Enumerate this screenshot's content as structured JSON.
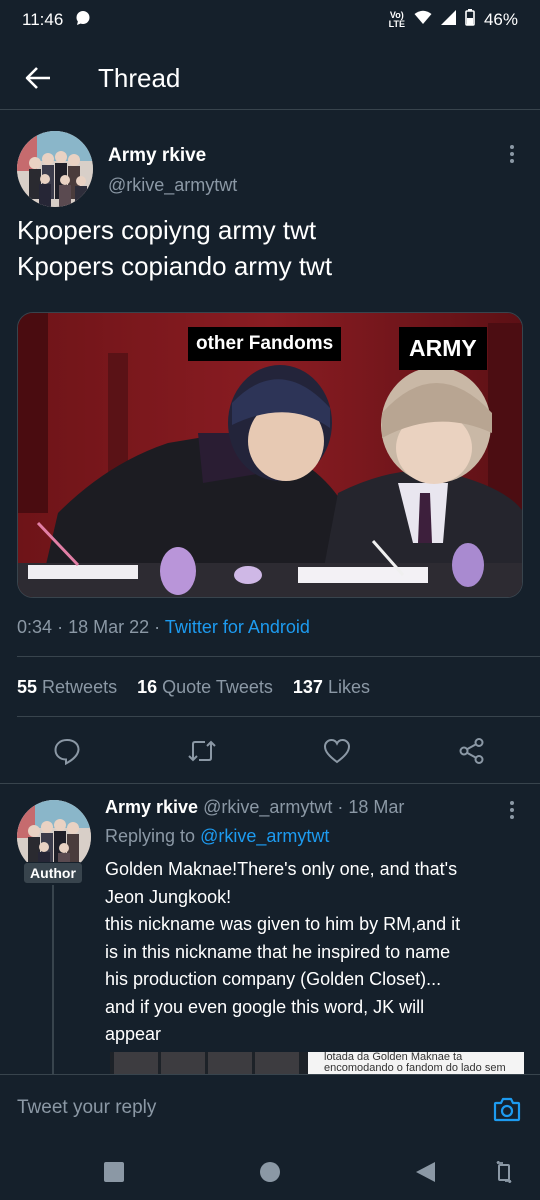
{
  "status_bar": {
    "time": "11:46",
    "volte_line1": "Vo)",
    "volte_line2": "LTE",
    "battery": "46%"
  },
  "header": {
    "title": "Thread",
    "back_icon": "arrow-left-icon"
  },
  "tweet": {
    "author_name": "Army rkive",
    "author_handle": "@rkive_armytwt",
    "text_lines": [
      "Kpopers copiyng army twt",
      "Kpopers copiando army twt"
    ],
    "media_captions": [
      "other Fandoms",
      "ARMY"
    ],
    "time": "0:34",
    "date": "18 Mar 22",
    "source": "Twitter for Android",
    "separator": "·",
    "stats": {
      "retweets_count": "55",
      "retweets_label": "Retweets",
      "quotes_count": "16",
      "quotes_label": "Quote Tweets",
      "likes_count": "137",
      "likes_label": "Likes"
    },
    "actions": [
      "reply-icon",
      "retweet-icon",
      "like-icon",
      "share-icon"
    ]
  },
  "reply": {
    "author_name": "Army rkive",
    "author_handle": "@rkive_armytwt",
    "date": "18 Mar",
    "badge": "Author",
    "replying_prefix": "Replying to",
    "replying_to": "@rkive_armytwt",
    "text_lines": [
      "Golden Maknae!There's only one, and that's",
      "Jeon Jungkook!",
      "this nickname was given to him by RM,and it",
      "is in this nickname that he inspired to name",
      "his production company (Golden Closet)...",
      "and if you even google this word, JK will",
      "appear"
    ],
    "media_snippet_line1": "lotada da Golden Maknae ta",
    "media_snippet_line2": "encomodando o fandom do lado sem"
  },
  "composer": {
    "placeholder": "Tweet your reply",
    "camera_icon": "camera-icon"
  },
  "nav_bar": [
    "recents-icon",
    "home-icon",
    "back-icon",
    "rotate-icon"
  ],
  "colors": {
    "background": "#15202b",
    "accent": "#1d9bf0",
    "secondary_text": "#8b98a5",
    "border": "#38444d"
  }
}
